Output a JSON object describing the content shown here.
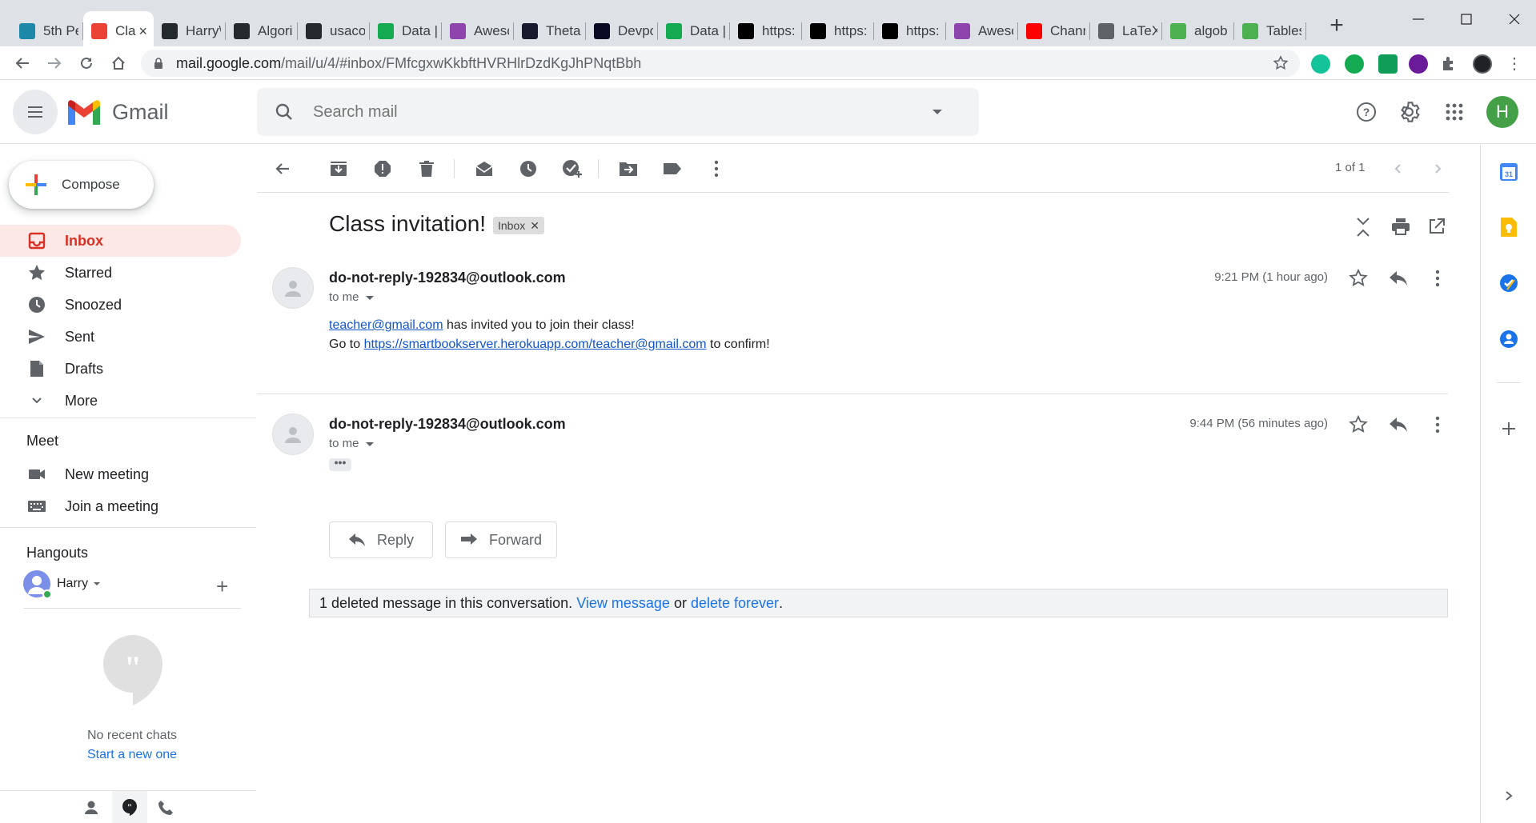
{
  "browser": {
    "tabs": [
      {
        "label": "5th Pe",
        "favicon_color": "#1e88a8"
      },
      {
        "label": "Cla",
        "favicon_color": "#ea4335",
        "active": true
      },
      {
        "label": "Harry\\",
        "favicon_color": "#24292e"
      },
      {
        "label": "Algori",
        "favicon_color": "#24292e"
      },
      {
        "label": "usaco",
        "favicon_color": "#24292e"
      },
      {
        "label": "Data |",
        "favicon_color": "#13aa52"
      },
      {
        "label": "Awesc",
        "favicon_color": "#8e44ad"
      },
      {
        "label": "Theta",
        "favicon_color": "#1a1a2e"
      },
      {
        "label": "Devpc",
        "favicon_color": "#0a0a23"
      },
      {
        "label": "Data |",
        "favicon_color": "#13aa52"
      },
      {
        "label": "https:",
        "favicon_color": "#000000"
      },
      {
        "label": "https:",
        "favicon_color": "#000000"
      },
      {
        "label": "https:",
        "favicon_color": "#000000"
      },
      {
        "label": "Awesc",
        "favicon_color": "#8e44ad"
      },
      {
        "label": "Chanr",
        "favicon_color": "#ff0000"
      },
      {
        "label": "LaTeX",
        "favicon_color": "#5f6368"
      },
      {
        "label": "algob",
        "favicon_color": "#4caf50"
      },
      {
        "label": "Tables",
        "favicon_color": "#4caf50"
      }
    ],
    "new_tab": "+",
    "url_host": "mail.google.com",
    "url_path": "/mail/u/4/#inbox/FMfcgxwKkbftHVRHlrDzdKgJhPNqtBbh"
  },
  "gmail": {
    "logo_text": "Gmail",
    "search_placeholder": "Search mail",
    "account_initial": "H"
  },
  "nav": {
    "compose": "Compose",
    "items": [
      {
        "label": "Inbox",
        "icon": "inbox-icon",
        "active": true
      },
      {
        "label": "Starred",
        "icon": "star-icon"
      },
      {
        "label": "Snoozed",
        "icon": "clock-icon"
      },
      {
        "label": "Sent",
        "icon": "send-icon"
      },
      {
        "label": "Drafts",
        "icon": "draft-icon"
      },
      {
        "label": "More",
        "icon": "chevron-down-icon"
      }
    ],
    "meet_title": "Meet",
    "meet_items": [
      {
        "label": "New meeting",
        "icon": "video-icon"
      },
      {
        "label": "Join a meeting",
        "icon": "keyboard-icon"
      }
    ],
    "hangouts_title": "Hangouts",
    "hangouts_user": "Harry",
    "no_chats": "No recent chats",
    "start_new": "Start a new one"
  },
  "toolbar": {
    "page_count": "1 of 1"
  },
  "thread": {
    "subject": "Class invitation!",
    "label_chip": "Inbox",
    "messages": [
      {
        "sender": "do-not-reply-192834@outlook.com",
        "to": "to me",
        "time": "9:21 PM (1 hour ago)",
        "body_link1": "teacher@gmail.com",
        "body_text1": " has invited you to join their class!",
        "body_prefix2": "Go to ",
        "body_link2": "https://smartbookserver.herokuapp.com/teacher@gmail.com",
        "body_text2": " to confirm!"
      },
      {
        "sender": "do-not-reply-192834@outlook.com",
        "to": "to me",
        "time": "9:44 PM (56 minutes ago)",
        "ellipsis": "•••"
      }
    ],
    "reply": "Reply",
    "forward": "Forward",
    "deleted_text": "1 deleted message in this conversation.",
    "view_message": "View message",
    "or": "or",
    "delete_forever": "delete forever",
    "period": "."
  }
}
